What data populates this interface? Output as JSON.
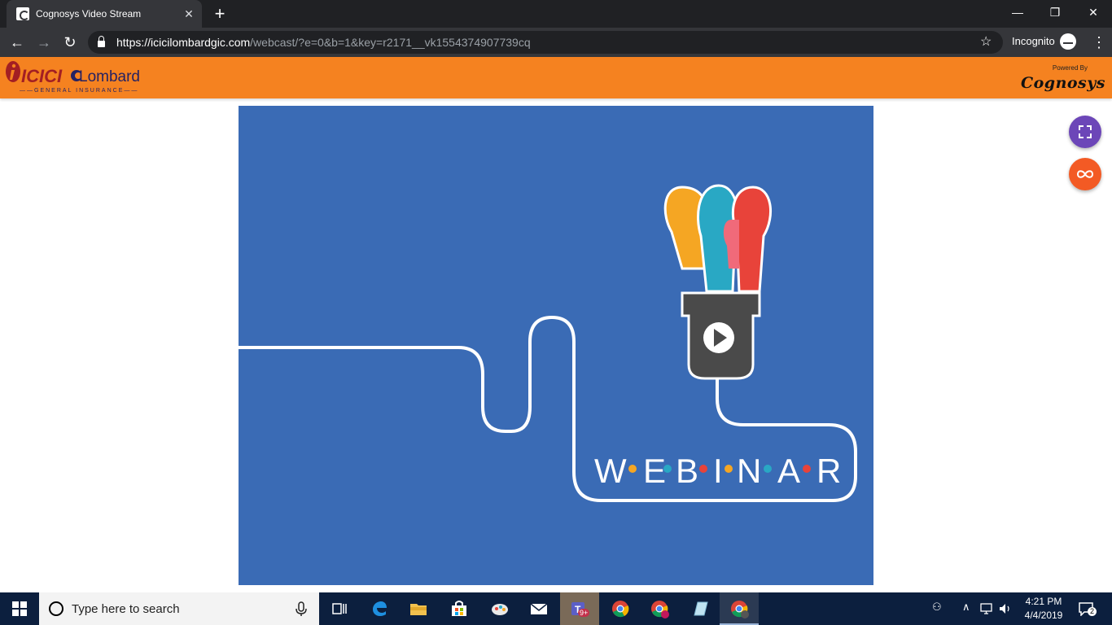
{
  "browser": {
    "tab_title": "Cognosys Video Stream",
    "tab_close": "✕",
    "new_tab": "+",
    "window_controls": {
      "minimize": "—",
      "restore": "❐",
      "close": "✕"
    },
    "back": "←",
    "forward": "→",
    "reload": "↻",
    "url_domain": "https://icicilombardgic.com",
    "url_path": "/webcast/?e=0&b=1&key=r2171__vk1554374907739cq",
    "bookmark": "☆",
    "mode_label": "Incognito",
    "menu": "⋮"
  },
  "site_header": {
    "logo_icici": "ICICI",
    "logo_lombard": "Lombard",
    "logo_tagline": "GENERAL INSURANCE",
    "powered_by": "Powered By",
    "brand": "Cognosys"
  },
  "video": {
    "letters": [
      "W",
      "E",
      "B",
      "I",
      "N",
      "A",
      "R"
    ],
    "dot_colors": [
      "#f5a623",
      "#29a8c4",
      "#e8433a",
      "#f5a623",
      "#29a8c4",
      "#e8433a"
    ]
  },
  "fab": {
    "fullscreen_color": "#6c46b8",
    "loop_color": "#f35a24"
  },
  "taskbar": {
    "search_placeholder": "Type here to search",
    "time": "4:21 PM",
    "date": "4/4/2019",
    "notification_count": "2",
    "teams_badge": "9+"
  }
}
